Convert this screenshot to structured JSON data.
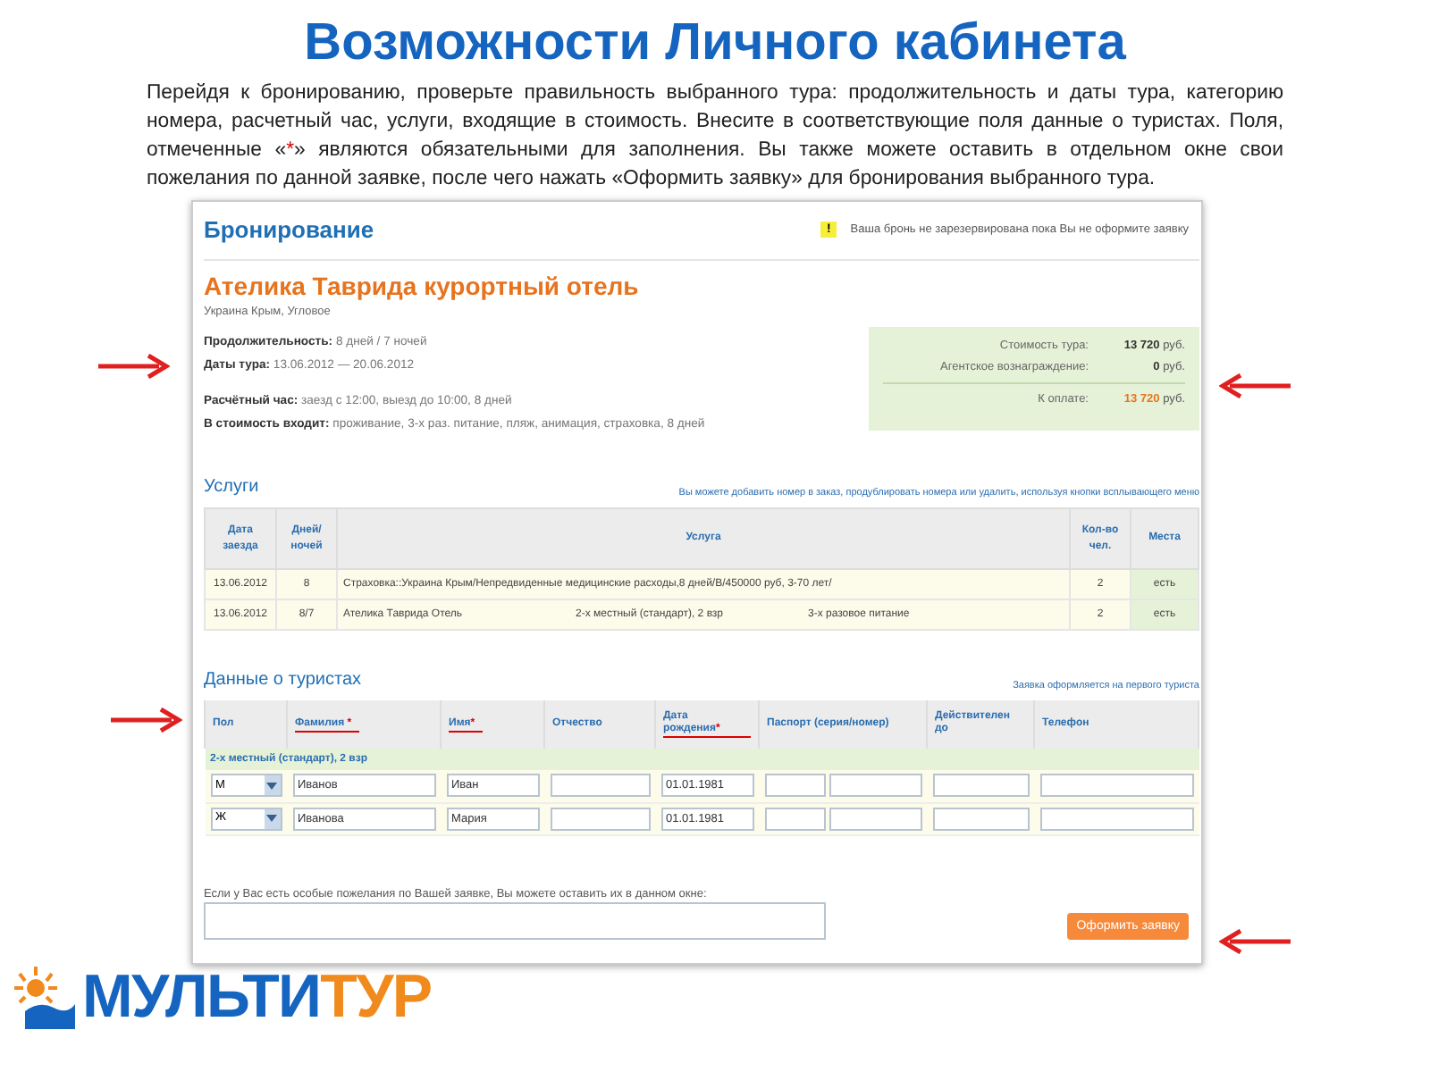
{
  "slide": {
    "title": "Возможности Личного кабинета",
    "intro": {
      "before": "Перейдя к бронированию, проверьте правильность выбранного тура: продолжительность и даты тура, категорию номера, расчетный час, услуги, входящие в стоимость. Внесите в соответствующие поля данные о туристах. Поля, отмеченные «",
      "mark": "*",
      "after": "» являются обязательными для заполнения. Вы также можете оставить в отдельном окне свои пожелания по данной заявке, после чего нажать «Оформить заявку» для бронирования выбранного тура."
    }
  },
  "booking": {
    "heading": "Бронирование",
    "notice_icon": "!",
    "notice": "Ваша бронь не зарезервирована пока Вы не оформите заявку"
  },
  "hotel": {
    "name": "Ателика Таврида курортный отель",
    "location": "Украина Крым, Угловое",
    "detail_groups": [
      [
        {
          "label": "Продолжительность:",
          "value": "8 дней / 7 ночей"
        },
        {
          "label": "Даты тура:",
          "value": "13.06.2012 — 20.06.2012"
        }
      ],
      [
        {
          "label": "Расчётный час:",
          "value": "заезд с 12:00, выезд до 10:00, 8 дней"
        },
        {
          "label": "В стоимость входит:",
          "value": "проживание, 3-х раз. питание, пляж, анимация, страховка, 8 дней"
        }
      ]
    ]
  },
  "prices": [
    {
      "label": "Стоимость тура:",
      "amount": "13 720",
      "unit": "руб.",
      "kind": "normal"
    },
    {
      "label": "Агентское вознаграждение:",
      "amount": "0",
      "unit": "руб.",
      "kind": "normal"
    },
    {
      "label": "К оплате:",
      "amount": "13 720",
      "unit": "руб.",
      "kind": "total"
    }
  ],
  "services": {
    "title": "Услуги",
    "hint": "Вы можете добавить номер в заказ, продублировать номера или удалить, используя кнопки всплывающего меню",
    "columns": [
      "Дата заезда",
      "Дней/ ночей",
      "Услуга",
      "Кол-во чел.",
      "Места"
    ],
    "rows": [
      {
        "date": "13.06.2012",
        "days": "8",
        "parts": [
          "Страховка::Украина Крым/Непредвиденные медицинские расходы,8 дней/B/450000 руб, 3-70 лет/"
        ],
        "people": "2",
        "places": "есть"
      },
      {
        "date": "13.06.2012",
        "days": "8/7",
        "parts": [
          "Ателика Таврида Отель",
          "2-х местный (стандарт), 2 взр",
          "3-х разовое питание"
        ],
        "people": "2",
        "places": "есть"
      }
    ]
  },
  "tourists": {
    "title": "Данные о туристах",
    "hint": "Заявка оформляется на первого туриста",
    "columns": [
      {
        "label": "Пол"
      },
      {
        "label": "Фамилия",
        "required_mark": " *"
      },
      {
        "label": "Имя",
        "required_mark": "*"
      },
      {
        "label": "Отчество"
      },
      {
        "label": "Дата рождения",
        "required_mark": "*"
      },
      {
        "label": "Паспорт (серия/номер)"
      },
      {
        "label": "Действителен до"
      },
      {
        "label": "Телефон"
      }
    ],
    "group": "2-х местный (стандарт), 2 взр",
    "rows": [
      {
        "gender": "М",
        "surname": "Иванов",
        "name": "Иван",
        "birthdate": "01.01.1981"
      },
      {
        "gender": "Ж",
        "surname": "Иванова",
        "name": "Мария",
        "birthdate": "01.01.1981"
      }
    ]
  },
  "wishes": {
    "label": "Если у Вас есть особые пожелания по Вашей заявке, Вы можете оставить их в данном окне:"
  },
  "submit": "Оформить заявку",
  "logo": {
    "first": "МУЛЬТИ",
    "second": "ТУР"
  }
}
